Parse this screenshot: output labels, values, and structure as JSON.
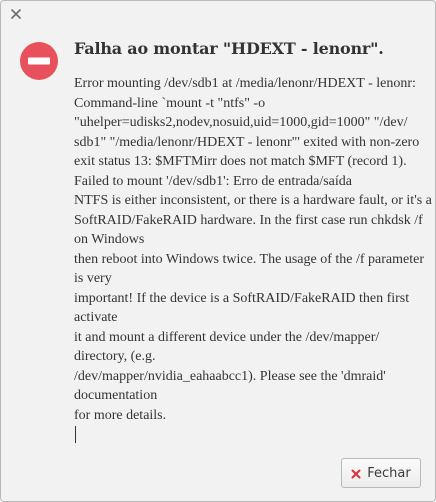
{
  "dialog": {
    "title": "Falha ao montar \"HDEXT - lenonr\".",
    "message_lines": [
      "Error mounting /dev/sdb1 at /media/lenonr/HDEXT - lenonr:",
      "Command-line `mount -t \"ntfs\" -o",
      "\"uhelper=udisks2,nodev,nosuid,uid=1000,gid=1000\" \"/dev/",
      "sdb1\" \"/media/lenonr/HDEXT - lenonr\"' exited with non-zero",
      "exit status 13: $MFTMirr does not match $MFT (record 1).",
      "Failed to mount '/dev/sdb1': Erro de entrada/saída",
      "NTFS is either inconsistent, or there is a hardware fault, or it's a",
      "SoftRAID/FakeRAID hardware. In the first case run chkdsk /f",
      "on Windows",
      "then reboot into Windows twice. The usage of the /f parameter",
      "is very",
      "important! If the device is a SoftRAID/FakeRAID then first",
      "activate",
      "it and mount a different device under the /dev/mapper/",
      "directory, (e.g.",
      "/dev/mapper/nvidia_eahaabcc1). Please see the 'dmraid'",
      "documentation",
      "for more details."
    ],
    "close_button_label": "Fechar",
    "icons": {
      "titlebar_close": "close-icon",
      "dialog": "error-icon",
      "button": "close-x-red-icon"
    },
    "colors": {
      "error_icon": "#e8505b",
      "button_x": "#d9333f",
      "background": "#f2f2f2",
      "text": "#333333"
    }
  }
}
